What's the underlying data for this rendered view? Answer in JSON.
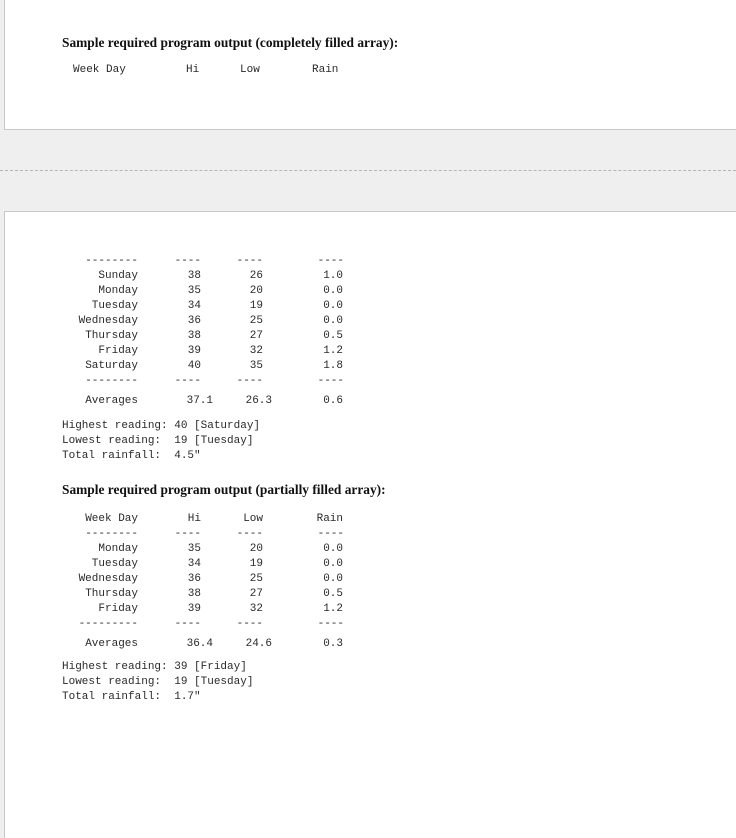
{
  "page_top": {
    "heading": "Sample required program output (completely filled array):",
    "headers": {
      "day": "Week Day",
      "hi": "Hi",
      "low": "Low",
      "rain": "Rain"
    }
  },
  "page_bottom": {
    "full_table": {
      "dash_day": "--------",
      "dash_col": "----",
      "rows": [
        {
          "day": "Sunday",
          "hi": "38",
          "low": "26",
          "rain": "1.0"
        },
        {
          "day": "Monday",
          "hi": "35",
          "low": "20",
          "rain": "0.0"
        },
        {
          "day": "Tuesday",
          "hi": "34",
          "low": "19",
          "rain": "0.0"
        },
        {
          "day": "Wednesday",
          "hi": "36",
          "low": "25",
          "rain": "0.0"
        },
        {
          "day": "Thursday",
          "hi": "38",
          "low": "27",
          "rain": "0.5"
        },
        {
          "day": "Friday",
          "hi": "39",
          "low": "32",
          "rain": "1.2"
        },
        {
          "day": "Saturday",
          "hi": "40",
          "low": "35",
          "rain": "1.8"
        }
      ],
      "averages": {
        "label": "Averages",
        "hi": "37.1",
        "low": "26.3",
        "rain": "0.6"
      },
      "summary": [
        "Highest reading: 40 [Saturday]",
        "Lowest reading:  19 [Tuesday]",
        "Total rainfall:  4.5\""
      ]
    },
    "partial_heading": "Sample required program output (partially filled array):",
    "partial_table": {
      "headers": {
        "day": "Week Day",
        "hi": "Hi",
        "low": "Low",
        "rain": "Rain"
      },
      "dash_day": "--------",
      "dash_col": "----",
      "dash_day_bottom": "---------",
      "rows": [
        {
          "day": "Monday",
          "hi": "35",
          "low": "20",
          "rain": "0.0"
        },
        {
          "day": "Tuesday",
          "hi": "34",
          "low": "19",
          "rain": "0.0"
        },
        {
          "day": "Wednesday",
          "hi": "36",
          "low": "25",
          "rain": "0.0"
        },
        {
          "day": "Thursday",
          "hi": "38",
          "low": "27",
          "rain": "0.5"
        },
        {
          "day": "Friday",
          "hi": "39",
          "low": "32",
          "rain": "1.2"
        }
      ],
      "averages": {
        "label": "Averages",
        "hi": "36.4",
        "low": "24.6",
        "rain": "0.3"
      },
      "summary": [
        "Highest reading: 39 [Friday]",
        "Lowest reading:  19 [Tuesday]",
        "Total rainfall:  1.7\""
      ]
    }
  }
}
